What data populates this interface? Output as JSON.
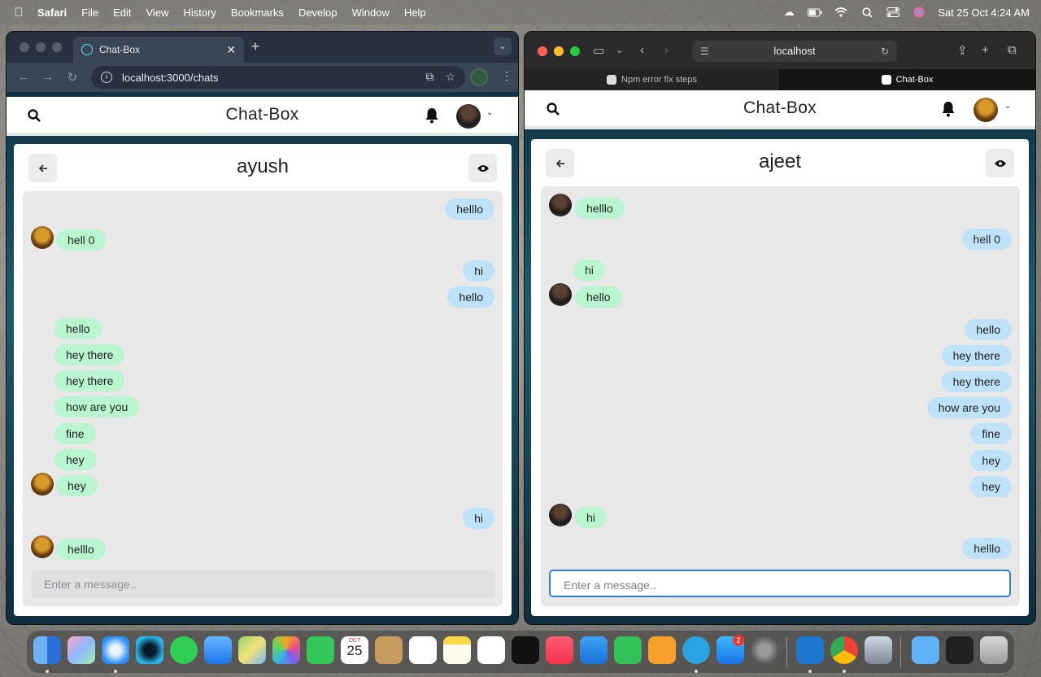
{
  "menubar": {
    "app_name": "Safari",
    "items": [
      "File",
      "Edit",
      "View",
      "History",
      "Bookmarks",
      "Develop",
      "Window",
      "Help"
    ],
    "clock": "Sat 25 Oct  4:24 AM"
  },
  "chrome_window": {
    "tab_title": "Chat-Box",
    "url": "localhost:3000/chats"
  },
  "safari_window": {
    "url": "localhost",
    "tabs": [
      "Npm error fix steps",
      "Chat-Box"
    ]
  },
  "app": {
    "brand": "Chat-Box",
    "input_placeholder": "Enter a message.."
  },
  "left_chat": {
    "title": "ayush",
    "messages": [
      {
        "text": "helllo",
        "side": "sent"
      },
      {
        "text": "hell 0",
        "side": "recv",
        "avatar": true
      },
      {
        "text": "hi",
        "side": "sent"
      },
      {
        "text": "hello",
        "side": "sent"
      },
      {
        "text": "hello",
        "side": "recv"
      },
      {
        "text": "hey there",
        "side": "recv"
      },
      {
        "text": "hey there",
        "side": "recv"
      },
      {
        "text": "how are you",
        "side": "recv"
      },
      {
        "text": "fine",
        "side": "recv"
      },
      {
        "text": "hey",
        "side": "recv"
      },
      {
        "text": "hey",
        "side": "recv",
        "avatar": true
      },
      {
        "text": "hi",
        "side": "sent"
      },
      {
        "text": "helllo",
        "side": "recv",
        "avatar": true
      }
    ]
  },
  "right_chat": {
    "title": "ajeet",
    "messages": [
      {
        "text": "helllo",
        "side": "recv",
        "avatar": true
      },
      {
        "text": "hell 0",
        "side": "sent"
      },
      {
        "text": "hi",
        "side": "recv"
      },
      {
        "text": "hello",
        "side": "recv",
        "avatar": true
      },
      {
        "text": "hello",
        "side": "sent"
      },
      {
        "text": "hey there",
        "side": "sent"
      },
      {
        "text": "hey there",
        "side": "sent"
      },
      {
        "text": "how are you",
        "side": "sent"
      },
      {
        "text": "fine",
        "side": "sent"
      },
      {
        "text": "hey",
        "side": "sent"
      },
      {
        "text": "hey",
        "side": "sent"
      },
      {
        "text": "hi",
        "side": "recv",
        "avatar": true
      },
      {
        "text": "helllo",
        "side": "sent"
      }
    ]
  },
  "dock": {
    "calendar_month": "OCT",
    "calendar_day": "25",
    "appstore_badge": "2"
  }
}
